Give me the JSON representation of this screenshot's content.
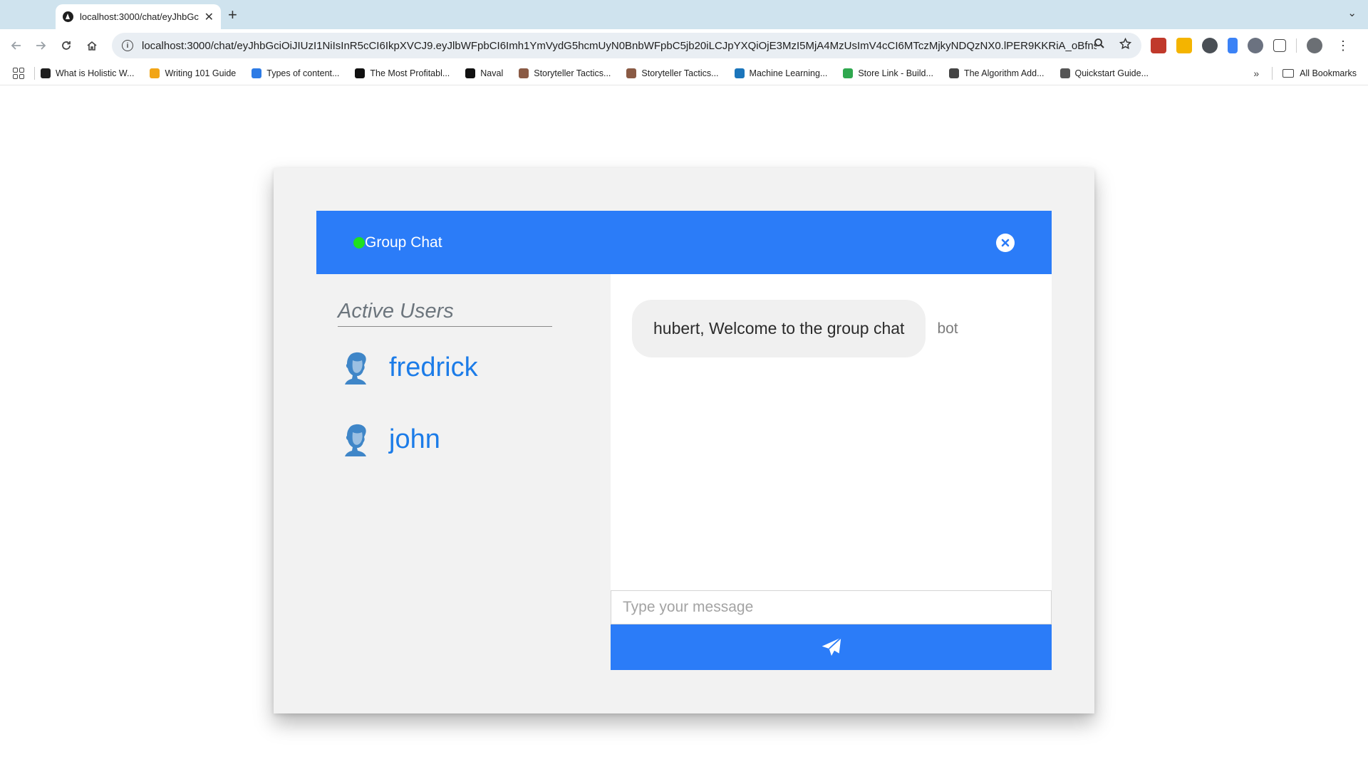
{
  "browser": {
    "tab_title": "localhost:3000/chat/eyJhbGc",
    "url": "localhost:3000/chat/eyJhbGciOiJIUzI1NiIsInR5cCI6IkpXVCJ9.eyJlbWFpbCI6Imh1YmVydG5hcmUyN0BnbWFpbC5jb20iLCJpYXQiOjE3MzI5MjA4MzUsImV4cCI6MTczMjkyNDQzNX0.lPER9KKRiA_oBfnsyh...",
    "bookmarks": [
      {
        "label": "What is Holistic W...",
        "icon": "letter-h-icon",
        "color": "#1f1f1f"
      },
      {
        "label": "Writing 101 Guide",
        "icon": "pencil-icon",
        "color": "#f2a516"
      },
      {
        "label": "Types of content...",
        "icon": "compass-icon",
        "color": "#2d7be5"
      },
      {
        "label": "The Most Profitabl...",
        "icon": "yc-icon",
        "color": "#111111"
      },
      {
        "label": "Naval",
        "icon": "naval-icon",
        "color": "#111111"
      },
      {
        "label": "Storyteller Tactics...",
        "icon": "storyteller-icon",
        "color": "#8a5a44"
      },
      {
        "label": "Storyteller Tactics...",
        "icon": "storyteller-icon",
        "color": "#8a5a44"
      },
      {
        "label": "Machine Learning...",
        "icon": "ml-icon",
        "color": "#1b75bb"
      },
      {
        "label": "Store Link - Build...",
        "icon": "basket-icon",
        "color": "#2fa84f"
      },
      {
        "label": "The Algorithm Add...",
        "icon": "algorithm-icon",
        "color": "#444444"
      },
      {
        "label": "Quickstart Guide...",
        "icon": "grid-doc-icon",
        "color": "#555555"
      }
    ],
    "all_bookmarks_label": "All Bookmarks"
  },
  "chat": {
    "header_title": "Group Chat",
    "online_color": "#1fe01f",
    "accent_color": "#2b7cf8",
    "active_users_heading": "Active Users",
    "users": [
      {
        "name": "fredrick",
        "avatar": "user-avatar-icon"
      },
      {
        "name": "john",
        "avatar": "user-avatar-icon"
      }
    ],
    "messages": [
      {
        "text": "hubert, Welcome to the group chat",
        "sender": "bot"
      }
    ],
    "input_placeholder": "Type your message",
    "input_value": "",
    "send_icon": "paper-plane-icon",
    "close_icon": "close-circle-icon"
  }
}
